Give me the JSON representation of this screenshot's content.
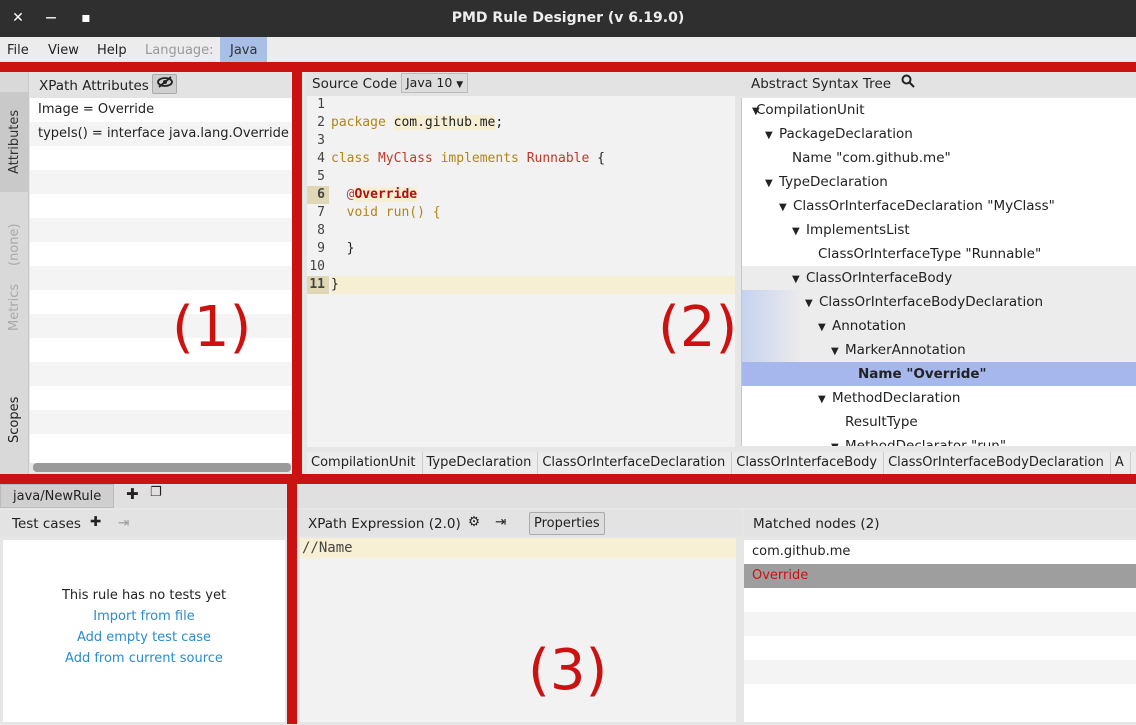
{
  "window": {
    "title": "PMD Rule Designer (v 6.19.0)",
    "close": "✕",
    "minimize": "—",
    "maximize": "▪"
  },
  "menu": {
    "file": "File",
    "view": "View",
    "help": "Help",
    "language_label": "Language:",
    "language_value": "Java"
  },
  "left_panel": {
    "title": "XPath Attributes",
    "vertical_tabs": [
      "Attributes",
      "(none)",
      "Metrics",
      "Scopes"
    ],
    "attributes": [
      "Image = Override",
      "typeIs() = interface java.lang.Override"
    ]
  },
  "source": {
    "title": "Source Code",
    "version": "Java 10",
    "line_numbers": [
      "1",
      "2",
      "3",
      "4",
      "5",
      "6",
      "7",
      "8",
      "9",
      "10",
      "11"
    ],
    "lines": {
      "l2_a": "package ",
      "l2_b": "com.github.me",
      "l2_c": ";",
      "l4_a": "class ",
      "l4_b": "MyClass",
      "l4_c": " implements ",
      "l4_d": "Runnable",
      "l4_e": " {",
      "l6_a": "  @",
      "l6_b": "Override",
      "l7": "  void run() {",
      "l9": "  }",
      "l11": "}"
    }
  },
  "ast": {
    "title": "Abstract Syntax Tree",
    "nodes": [
      "CompilationUnit",
      "PackageDeclaration",
      "Name \"com.github.me\"",
      "TypeDeclaration",
      "ClassOrInterfaceDeclaration \"MyClass\"",
      "ImplementsList",
      "ClassOrInterfaceType \"Runnable\"",
      "ClassOrInterfaceBody",
      "ClassOrInterfaceBodyDeclaration",
      "Annotation",
      "MarkerAnnotation",
      "Name \"Override\"",
      "MethodDeclaration",
      "ResultType",
      "MethodDeclarator \"run\""
    ]
  },
  "breadcrumbs": [
    "CompilationUnit",
    "TypeDeclaration",
    "ClassOrInterfaceDeclaration",
    "ClassOrInterfaceBody",
    "ClassOrInterfaceBodyDeclaration",
    "A"
  ],
  "rule_tab": "java/NewRule",
  "tests": {
    "title": "Test cases",
    "empty_message": "This rule has no tests yet",
    "import": "Import from file",
    "add_empty": "Add empty test case",
    "add_current": "Add from current source"
  },
  "xpath": {
    "title": "XPath Expression (2.0)",
    "properties": "Properties",
    "expression": "//Name"
  },
  "matched": {
    "title": "Matched nodes (2)",
    "items": [
      "com.github.me",
      "Override"
    ]
  },
  "annotations": [
    "(1)",
    "(2)",
    "(3)"
  ]
}
